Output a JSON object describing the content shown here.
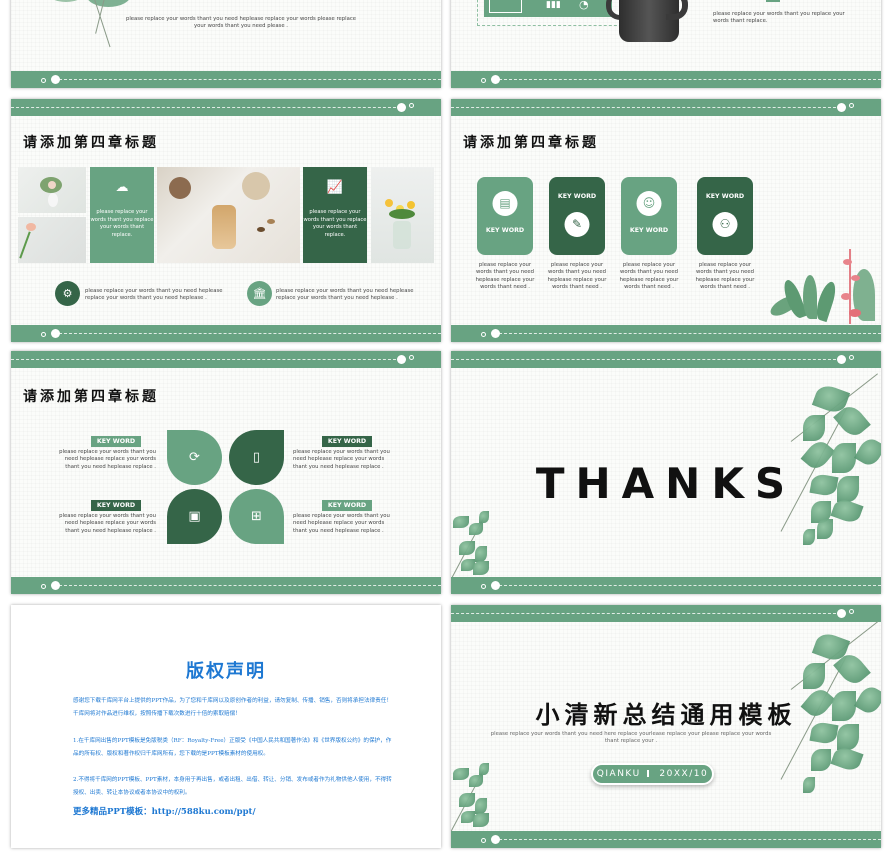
{
  "theme": {
    "accent_light": "#68a382",
    "accent_dark": "#356548",
    "copyright_blue": "#1e78d2"
  },
  "slide1": {
    "description": "please replace your  words thant  you need heplease replace your  words please replace your  words thant  you need please ."
  },
  "slide2": {
    "icons": [
      "presenter-icon",
      "bar-chart-icon",
      "donut-chart-icon"
    ],
    "description": "please replace your words thant  you replace your words thant  replace."
  },
  "slide3": {
    "title": "请添加第四章标题",
    "card_left_text": "please replace your words thant you replace your words thant replace.",
    "card_right_text": "please replace your words thant you replace your words thant replace.",
    "bottom_items": [
      {
        "icon": "gear-wrench-icon",
        "text": "please replace your  words thant  you need heplease replace your  words thant  you need heplease ."
      },
      {
        "icon": "bank-icon",
        "text": "please replace your  words thant  you need heplease replace your  words thant  you need heplease ."
      }
    ]
  },
  "slide4": {
    "title": "请添加第四章标题",
    "cards": [
      {
        "label": "KEY WORD",
        "icon": "notebook-icon",
        "style": "light",
        "desc": "please replace your words thant  you need heplease replace your  words thant  need ."
      },
      {
        "label": "KEY WORD",
        "icon": "browser-edit-icon",
        "style": "dark",
        "desc": "please replace your words thant  you need heplease replace your  words thant  need ."
      },
      {
        "label": "KEY WORD",
        "icon": "person-chat-icon",
        "style": "light",
        "desc": "please replace your words thant  you need heplease replace your  words thant  need ."
      },
      {
        "label": "KEY WORD",
        "icon": "team-icon",
        "style": "dark",
        "desc": "please replace your words thant  you need heplease replace your  words thant  need ."
      }
    ]
  },
  "slide5": {
    "title": "请添加第四章标题",
    "items": [
      {
        "label": "KEY WORD",
        "desc": "please replace your  words thant  you need heplease replace your  words thant you need heplease replace ."
      },
      {
        "label": "KEY WORD",
        "desc": "please replace your  words thant  you need heplease replace your  words thant you need heplease replace ."
      },
      {
        "label": "KEY WORD",
        "desc": "please replace your  words thant  you need heplease replace your  words thant you need heplease replace ."
      },
      {
        "label": "KEY WORD",
        "desc": "please replace your  words thant  you need heplease replace your  words thant you need heplease replace ."
      }
    ],
    "icons": [
      "cycle-people-icon",
      "tablet-chart-icon",
      "mobile-id-icon",
      "browser-box-icon"
    ]
  },
  "slide6": {
    "thanks": "THANKS"
  },
  "slide7": {
    "title": "版权声明",
    "para1": "感谢您下载千库网平台上提供的PPT作品，为了您和千库网以及原创作者的利益，请勿复制、传播、销售，否则将承担法律责任！千库网将对作品进行维权，按照传播下载次数进行十倍的索取赔偿！",
    "para2": "1.在千库网出售的PPT模板是免版税类（RF：Royalty-Free）正版受《中国人民共和国著作法》和《世界版权公约》的保护，作品的所有权、版权和著作权归千库网所有，您下载的是PPT模板素材的使用权。",
    "para3": "2.不得将千库网的PPT模板、PPT素材，本身用于再出售，或者出租、出借、转让、分销、发布或者作为礼物供他人使用，不得转授权、出卖、转让本协议或者本协议中的权利。",
    "more": "更多精品PPT模板：http://588ku.com/ppt/"
  },
  "slide8": {
    "title": "小清新总结通用模板",
    "subtitle": "please replace your  words thant  you need here replace yourlease replace your please replace your  words thant replace your  .",
    "author": "QIANKU",
    "date": "20XX/10"
  }
}
